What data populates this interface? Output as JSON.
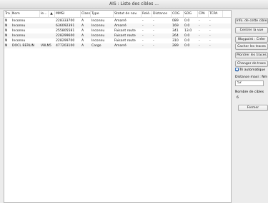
{
  "window": {
    "title": "AIS : Liste des cibles ..."
  },
  "table": {
    "columns": [
      "Tra",
      "Nom",
      "le...",
      "MMSI",
      "Classe",
      "Type",
      "Statut de nav.",
      "Relè...",
      "Distance",
      "COG",
      "SOG",
      "CPA",
      "TCPA"
    ],
    "sort_indicator": "▲",
    "rows": [
      [
        "N",
        "Inconnu",
        "",
        "228333700",
        "A",
        "Inconnu",
        "Amarré",
        "-",
        "-",
        "089",
        "0.0",
        "-",
        "-"
      ],
      [
        "N",
        "Inconnu",
        "",
        "636092391",
        "A",
        "Inconnu",
        "Amarré",
        "-",
        "-",
        "169",
        "0.0",
        "-",
        "-"
      ],
      [
        "N",
        "Inconnu",
        "",
        "255805581",
        "A",
        "Inconnu",
        "Faisant route",
        "-",
        "-",
        "341",
        "13.0",
        "-",
        "-"
      ],
      [
        "N",
        "Inconnu",
        "",
        "228299600",
        "A",
        "Inconnu",
        "Faisant route",
        "-",
        "-",
        "264",
        "0.0",
        "-",
        "-"
      ],
      [
        "N",
        "Inconnu",
        "",
        "228299700",
        "A",
        "Inconnu",
        "Faisant route",
        "-",
        "-",
        "310",
        "0.0",
        "-",
        "-"
      ],
      [
        "N",
        "DOCL BERLIN",
        "V8LN5",
        "477203100",
        "A",
        "Cargo",
        "Amarré",
        "-",
        "-",
        "289",
        "0.0",
        "-",
        "-"
      ]
    ]
  },
  "side": {
    "info_button": "Info. de cette cible",
    "center_button": "Centrer la vue",
    "waypoint_button": "Waypoint : Créer",
    "hide_tracks_button": "Cacher les traces",
    "show_tracks_button": "Montrer les traces",
    "change_track_button": "Changer de trace",
    "auto_sort_label": "Tri automatique",
    "auto_sort_checked": true,
    "max_distance_label": "Distance maxi : Nm",
    "max_distance_value": "52",
    "num_targets_label": "Nombre de cibles",
    "num_targets_value": "6",
    "close_button": "Fermer"
  }
}
